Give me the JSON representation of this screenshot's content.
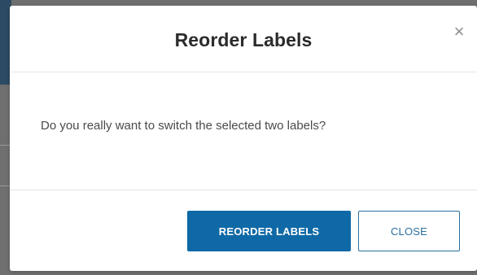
{
  "modal": {
    "title": "Reorder Labels",
    "close_glyph": "×",
    "message": "Do you really want to switch the selected two labels?",
    "confirm_label": "REORDER LABELS",
    "cancel_label": "CLOSE"
  },
  "colors": {
    "primary": "#0f69a6",
    "secondary_text": "#2a6f9f",
    "backdrop": "#6f6f6f"
  },
  "icons": {
    "close": "close-icon"
  }
}
